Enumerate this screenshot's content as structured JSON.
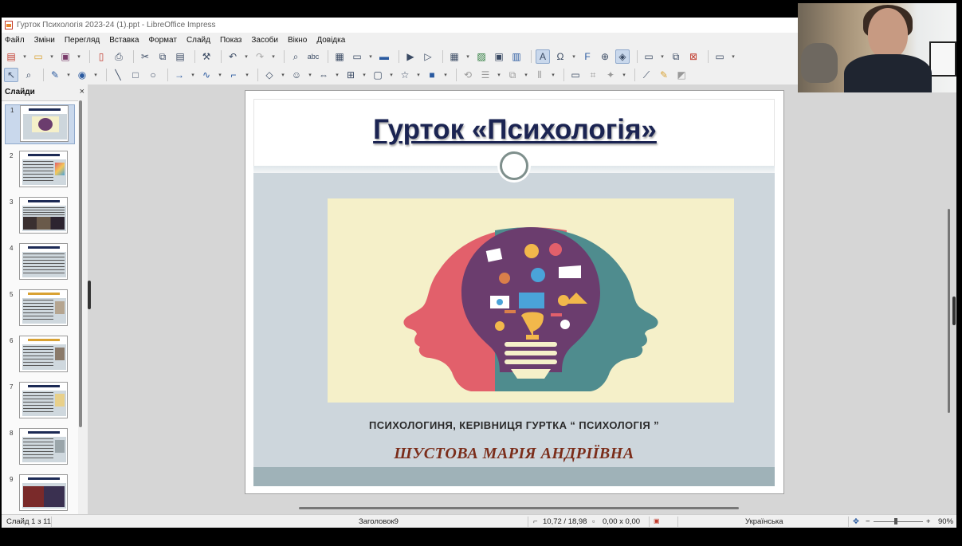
{
  "window": {
    "title": "Гурток Психологія 2023-24 (1).ppt - LibreOffice Impress"
  },
  "menu": [
    "Файл",
    "Зміни",
    "Перегляд",
    "Вставка",
    "Формат",
    "Слайд",
    "Показ",
    "Засоби",
    "Вікно",
    "Довідка"
  ],
  "toolbar1_icons": [
    "new-document-icon",
    "open-folder-icon",
    "save-icon",
    "export-pdf-icon",
    "print-icon",
    "cut-icon",
    "copy-icon",
    "paste-icon",
    "clone-formatting-icon",
    "undo-icon",
    "redo-icon",
    "find-replace-icon",
    "spellcheck-icon",
    "grid-icon",
    "display-views-icon",
    "master-slide-icon",
    "start-presentation-icon",
    "start-current-slide-icon",
    "table-icon",
    "image-icon",
    "media-icon",
    "chart-icon",
    "textbox-icon",
    "special-character-icon",
    "fontwork-icon",
    "hyperlink-icon",
    "show-draw-functions-icon",
    "new-slide-icon",
    "duplicate-slide-icon",
    "delete-slide-icon",
    "slide-layout-icon"
  ],
  "toolbar2_icons": [
    "select-icon",
    "zoom-icon",
    "line-color-icon",
    "fill-color-icon",
    "line-tool-icon",
    "rectangle-icon",
    "ellipse-icon",
    "arrow-line-icon",
    "curve-icon",
    "connector-icon",
    "basic-shapes-icon",
    "symbol-shapes-icon",
    "block-arrows-icon",
    "flowchart-icon",
    "callout-icon",
    "stars-icon",
    "3d-objects-icon",
    "rotate-icon",
    "align-icon",
    "arrange-icon",
    "distribute-icon",
    "shadow-icon",
    "crop-icon",
    "filter-icon",
    "toggle-points-icon",
    "glue-points-icon",
    "extrusion-icon"
  ],
  "slides_panel": {
    "title": "Слайди",
    "close": "×",
    "slide_numbers": [
      "1",
      "2",
      "3",
      "4",
      "5",
      "6",
      "7",
      "8",
      "9"
    ],
    "selected_index": 0
  },
  "slide": {
    "title": "Гурток «Психологія»",
    "subtitle": "ПСИХОЛОГИНЯ, КЕРІВНИЦЯ ГУРТКА “ ПСИХОЛОГІЯ ”",
    "presenter": "ШУСТОВА МАРІЯ АНДРІЇВНА",
    "colors": {
      "title": "#1b2452",
      "presenter": "#7b2d1a",
      "body_bg": "#cdd6dc",
      "image_bg": "#f5f0c9",
      "head_left": "#e2606b",
      "head_right": "#4f8c8e",
      "bulb": "#6b3d6e"
    }
  },
  "statusbar": {
    "slide_counter": "Слайд 1 з 11",
    "layout_name": "Заголовок9",
    "position": "10,72 / 18,98",
    "size": "0,00 x 0,00",
    "language": "Українська",
    "zoom_minus": "−",
    "zoom_plus": "+",
    "zoom_level": "90%"
  }
}
